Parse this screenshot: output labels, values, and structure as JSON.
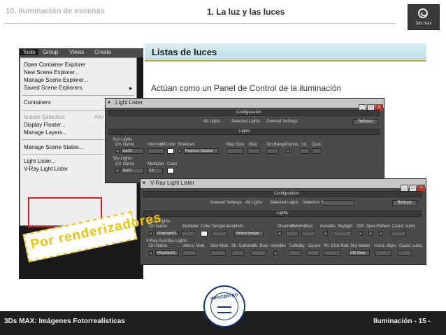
{
  "header": {
    "left": "10. Iluminación de escenas",
    "center": "1. La luz y las luces",
    "logo_text": "3ds max"
  },
  "slide": {
    "title": "Listas de luces",
    "description": "Actúan como un Panel de Control de la iluminación"
  },
  "menu": {
    "bar": [
      "Tools",
      "Group",
      "Views",
      "Create"
    ],
    "items": [
      "Open Container Explorer",
      "New Scene Explorer...",
      "Manage Scene Explorer...",
      "Saved Scene Explorers",
      "Containers",
      "Isolate Selection",
      "Display Floater...",
      "Manage Layers...",
      "Manage Scene States...",
      "Light Lister...",
      "V-Ray Light Lister"
    ],
    "shortcut": "Alt+"
  },
  "light_lister": {
    "title": "Light Lister",
    "configuration": "Configuration",
    "options": [
      "All Lights",
      "Selected Lights",
      "General Settings"
    ],
    "refresh": "Refresh",
    "lights_header": "Lights",
    "sun_lights": "Sun Lights",
    "sun_cols": [
      "On",
      "Name",
      "Intensity",
      "AtColor",
      "Shadows",
      "Map Size",
      "Bias",
      "Sm.Range",
      "Transp.",
      "Int.",
      "Qual."
    ],
    "sun_name": "Sun01",
    "sun_shadow": "Raytrace Shadow",
    "sky_lights": "Sky Lights",
    "sky_cols": [
      "On",
      "Name",
      "Multiplier",
      "Color"
    ],
    "sky_name": "Sky01",
    "sky_mult": "0,9"
  },
  "vray_lister": {
    "title": "V-Ray Light Lister",
    "configuration": "Configuration",
    "options": [
      "General Settings",
      "All Lights",
      "Selected Lights",
      "Selection Set:"
    ],
    "refresh": "Refresh",
    "lights_header": "Lights",
    "vray_lights": "V-Ray Lights",
    "light_cols": [
      "On",
      "Name",
      "Multiplier",
      "Color",
      "Temperature",
      "Units",
      "Shadows",
      "Subdivs",
      "Bias",
      "Invisible",
      "Skylight",
      "Diff.",
      "Spec.",
      "Reflect.",
      "Caust. subd."
    ],
    "light_name": "VRayLight01",
    "light_units": "Default (image)",
    "sun_header": "V-Ray Sun/Sky Lights",
    "sun_cols": [
      "On",
      "Name",
      "Intens. Mult.",
      "Size Mult.",
      "Sh. Subdivs",
      "Sh. Bias",
      "Invisible",
      "Turbidity",
      "Ozone",
      "Ph. Emit Rad.",
      "Sky Model",
      "Horiz. Illum.",
      "Caust. subd."
    ],
    "sun_name": "VRaySun01",
    "sky_model": "CIE Clear"
  },
  "stamp": "Por renderizadores",
  "footer": {
    "left": "3Ds MAX: Imágenes Fotorrealísticas",
    "right": "Iluminación  - 15 -",
    "seal_text": "INFOCENTRO"
  },
  "colors": {
    "title_accent": "#e0a020",
    "highlight_box": "#d42020",
    "stamp": "#f2c200",
    "footer_bg": "#1f1f1f"
  }
}
